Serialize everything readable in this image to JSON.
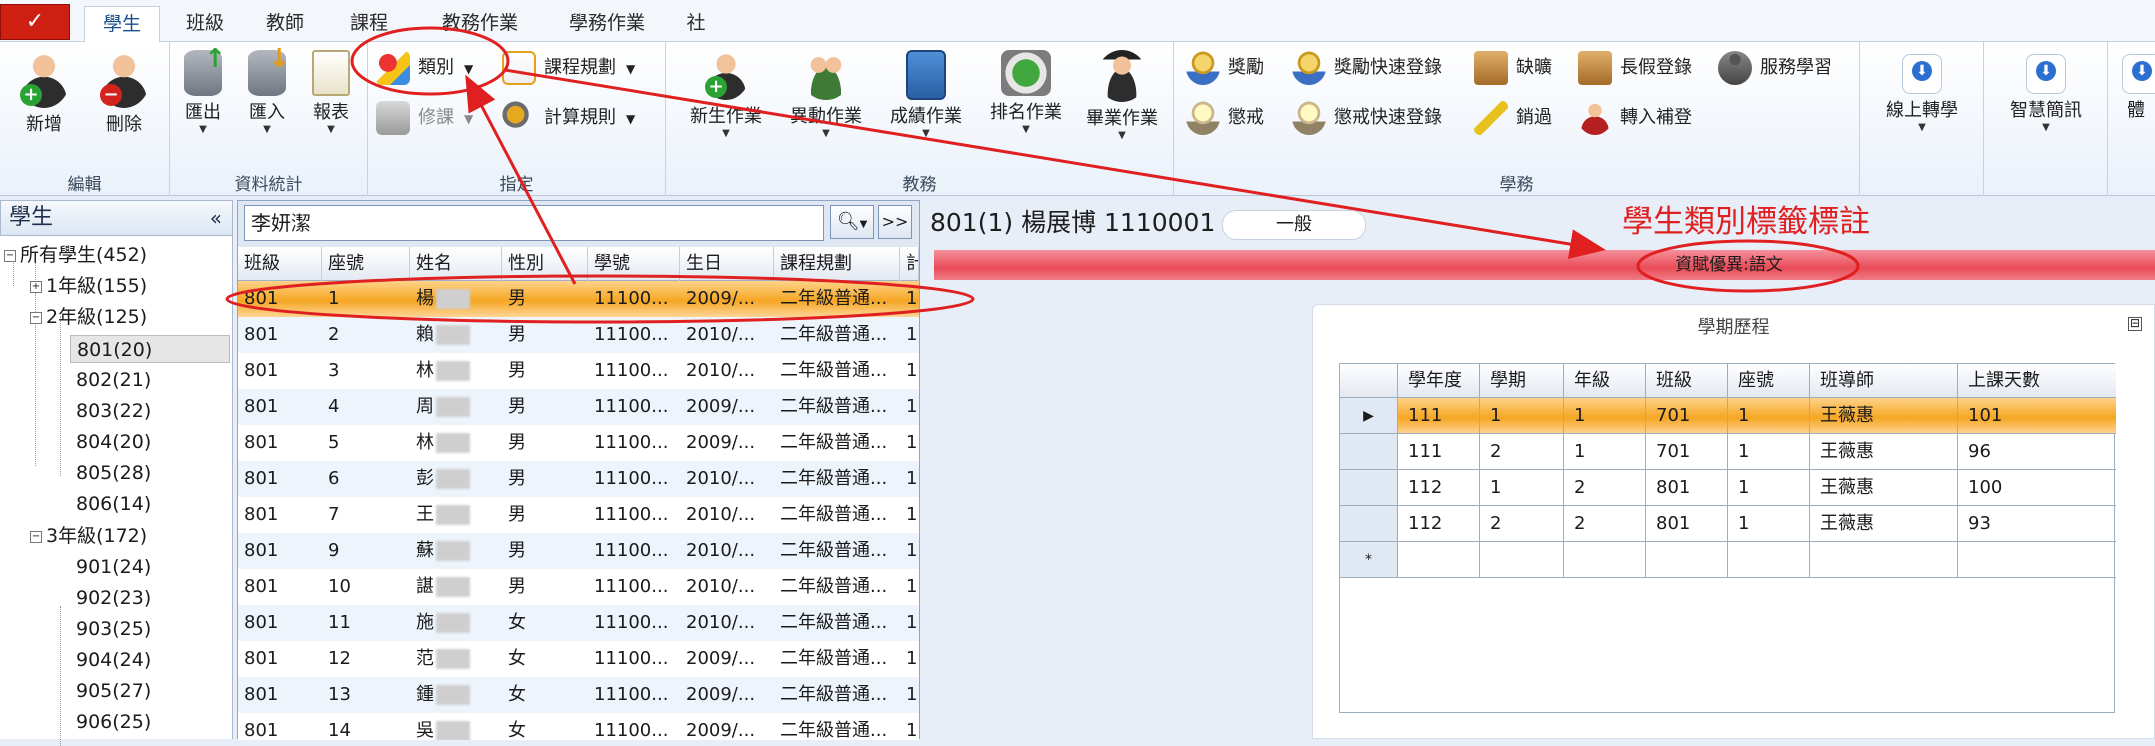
{
  "tabs": {
    "app_button": "✓",
    "items": [
      "學生",
      "班級",
      "教師",
      "課程",
      "教務作業",
      "學務作業",
      "社團"
    ]
  },
  "ribbon": {
    "edit": {
      "label": "編輯",
      "add": "新增",
      "delete": "刪除"
    },
    "stats": {
      "label": "資料統計",
      "export": "匯出",
      "import": "匯入",
      "report": "報表"
    },
    "assign": {
      "label": "指定",
      "category": "類別",
      "course_rule": "課程規劃",
      "edit_course": "修課",
      "calc_rule": "計算規則"
    },
    "academic": {
      "label": "教務",
      "new_student": "新生作業",
      "transfer": "異動作業",
      "grade": "成績作業",
      "ranking": "排名作業",
      "graduation": "畢業作業"
    },
    "student_affairs": {
      "label": "學務",
      "reward": "獎勵",
      "reward_quick": "獎勵快速登錄",
      "absence": "缺曠",
      "long_leave": "長假登錄",
      "service": "服務學習",
      "punish": "懲戒",
      "punish_quick": "懲戒快速登錄",
      "cancel": "銷過",
      "transfer_in": "轉入補登"
    },
    "online_transfer": "線上轉學",
    "smart_sms": "智慧簡訊",
    "health": "體"
  },
  "nav": {
    "title": "學生",
    "collapse": "«",
    "tree": [
      "所有學生(452)",
      "1年級(155)",
      "2年級(125)",
      "801(20)",
      "802(21)",
      "803(22)",
      "804(20)",
      "805(28)",
      "806(14)",
      "3年級(172)",
      "901(24)",
      "902(23)",
      "903(25)",
      "904(24)",
      "905(27)",
      "906(25)"
    ]
  },
  "list": {
    "search_value": "李妍潔",
    "search_icon": "magnifier-icon",
    "nav_label": ">>",
    "columns": [
      "班級",
      "座號",
      "姓名",
      "性別",
      "學號",
      "生日",
      "課程規劃",
      "計"
    ],
    "rows": [
      [
        "801",
        "1",
        "楊",
        "男",
        "11100...",
        "2009/...",
        "二年級普通...",
        "1"
      ],
      [
        "801",
        "2",
        "賴",
        "男",
        "11100...",
        "2010/...",
        "二年級普通...",
        "1"
      ],
      [
        "801",
        "3",
        "林",
        "男",
        "11100...",
        "2010/...",
        "二年級普通...",
        "1"
      ],
      [
        "801",
        "4",
        "周",
        "男",
        "11100...",
        "2009/...",
        "二年級普通...",
        "1"
      ],
      [
        "801",
        "5",
        "林",
        "男",
        "11100...",
        "2009/...",
        "二年級普通...",
        "1"
      ],
      [
        "801",
        "6",
        "彭",
        "男",
        "11100...",
        "2010/...",
        "二年級普通...",
        "1"
      ],
      [
        "801",
        "7",
        "王",
        "男",
        "11100...",
        "2010/...",
        "二年級普通...",
        "1"
      ],
      [
        "801",
        "9",
        "蘇",
        "男",
        "11100...",
        "2010/...",
        "二年級普通...",
        "1"
      ],
      [
        "801",
        "10",
        "諶",
        "男",
        "11100...",
        "2010/...",
        "二年級普通...",
        "1"
      ],
      [
        "801",
        "11",
        "施",
        "女",
        "11100...",
        "2010/...",
        "二年級普通...",
        "1"
      ],
      [
        "801",
        "12",
        "范",
        "女",
        "11100...",
        "2009/...",
        "二年級普通...",
        "1"
      ],
      [
        "801",
        "13",
        "鍾",
        "女",
        "11100...",
        "2009/...",
        "二年級普通...",
        "1"
      ],
      [
        "801",
        "14",
        "吳",
        "女",
        "11100...",
        "2009/...",
        "二年級普通...",
        "1"
      ]
    ]
  },
  "detail": {
    "title": "801(1) 楊展博 1110001",
    "status": "一般",
    "tag": "資賦優異:語文",
    "panel_title": "學期歷程",
    "collapse": "⊟",
    "history_columns": [
      "學年度",
      "學期",
      "年級",
      "班級",
      "座號",
      "班導師",
      "上課天數"
    ],
    "history_rows": [
      [
        "111",
        "1",
        "1",
        "701",
        "1",
        "王薇惠",
        "101"
      ],
      [
        "111",
        "2",
        "1",
        "701",
        "1",
        "王薇惠",
        "96"
      ],
      [
        "112",
        "1",
        "2",
        "801",
        "1",
        "王薇惠",
        "100"
      ],
      [
        "112",
        "2",
        "2",
        "801",
        "1",
        "王薇惠",
        "93"
      ]
    ],
    "new_row_marker": "*"
  },
  "annotation": {
    "text": "學生類別標籤標註",
    "color": "#e02020"
  }
}
